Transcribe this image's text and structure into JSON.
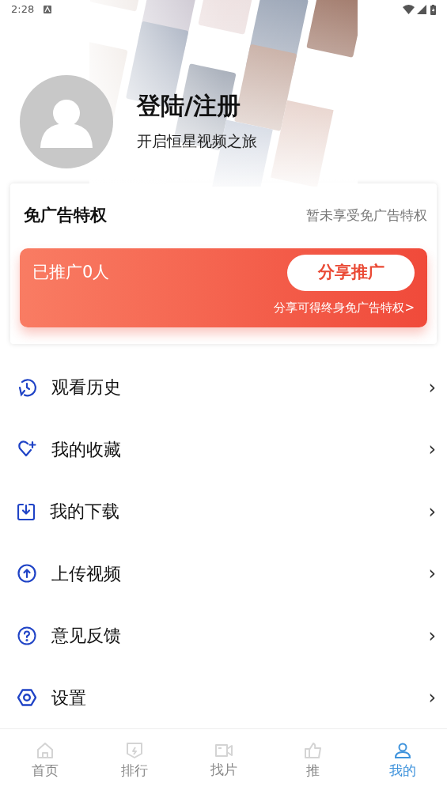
{
  "status_bar": {
    "time": "2:28"
  },
  "profile": {
    "title": "登陆/注册",
    "subtitle": "开启恒星视频之旅"
  },
  "ad_free": {
    "title": "免广告特权",
    "status": "暂未享受免广告特权",
    "promoted": "已推广0人",
    "share_button": "分享推广",
    "hint": "分享可得终身免广告特权>"
  },
  "menu": [
    {
      "label": "观看历史",
      "chevron": "›"
    },
    {
      "label": "我的收藏",
      "chevron": "›"
    },
    {
      "label": "我的下载",
      "chevron": "›"
    },
    {
      "label": "上传视频",
      "chevron": "›"
    },
    {
      "label": "意见反馈",
      "chevron": "›"
    },
    {
      "label": "设置",
      "chevron": "›"
    }
  ],
  "tabs": [
    {
      "label": "首页",
      "selected": false
    },
    {
      "label": "排行",
      "selected": false
    },
    {
      "label": "找片",
      "selected": false
    },
    {
      "label": "推",
      "selected": false
    },
    {
      "label": "我的",
      "selected": true
    }
  ]
}
